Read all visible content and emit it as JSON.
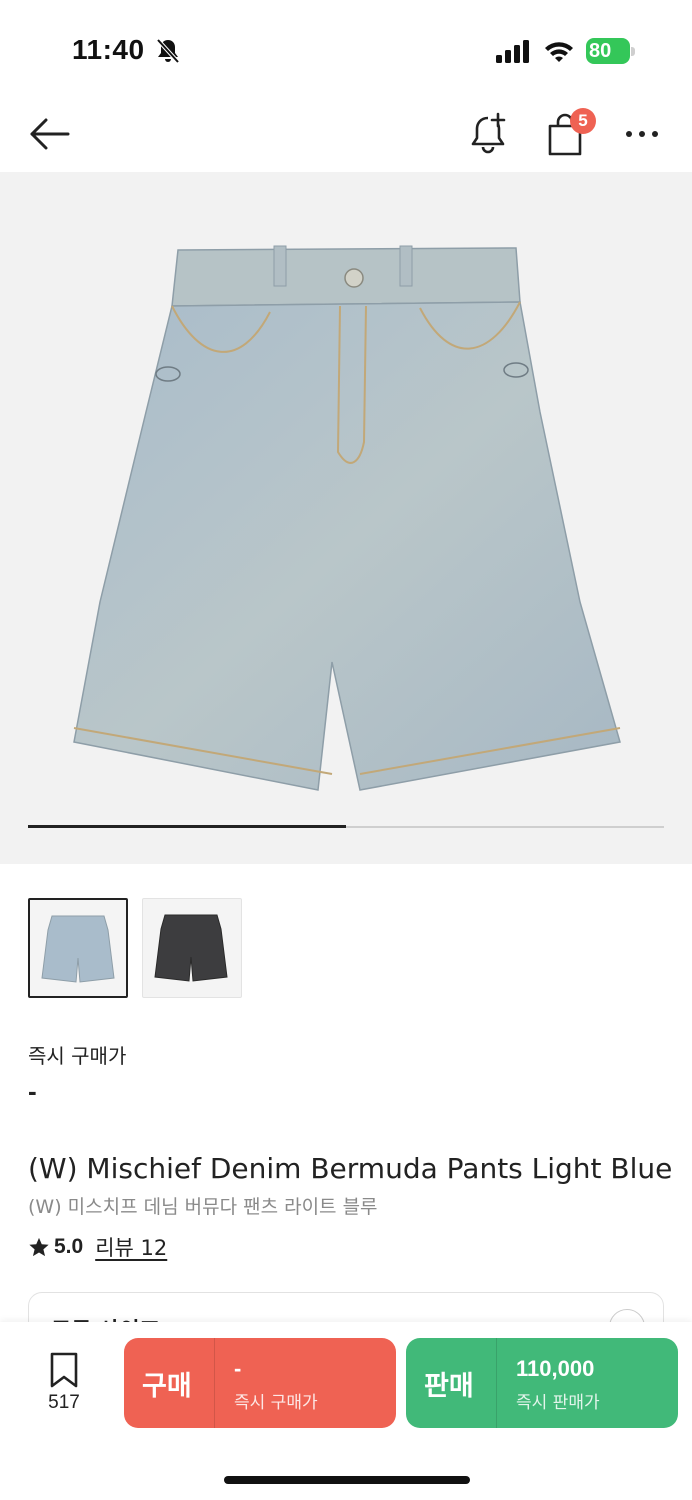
{
  "status_bar": {
    "time": "11:40",
    "battery": "80"
  },
  "nav": {
    "cart_count": "5",
    "icons": [
      "back-arrow-icon",
      "bell-add-icon",
      "shopping-bag-icon",
      "more-icon"
    ]
  },
  "gallery": {
    "image_progress": 0.5,
    "thumbnails": [
      "light-blue",
      "black"
    ]
  },
  "product": {
    "price_label": "즉시 구매가",
    "price_value": "-",
    "title_en": "(W) Mischief Denim Bermuda Pants Light Blue",
    "title_ko": "(W) 미스치프 데님 버뮤다 팬츠 라이트 블루",
    "rating": "5.0",
    "review_label": "리뷰 12"
  },
  "size_selector": {
    "label": "모든 사이즈"
  },
  "bottom_bar": {
    "wish_count": "517",
    "buy_label": "구매",
    "buy_price": "-",
    "buy_sub": "즉시 구매가",
    "sell_label": "판매",
    "sell_price": "110,000",
    "sell_sub": "즉시 판매가"
  },
  "colors": {
    "buy": "#ef6253",
    "sell": "#41b979",
    "badge": "#ef6253",
    "battery": "#34c759"
  }
}
